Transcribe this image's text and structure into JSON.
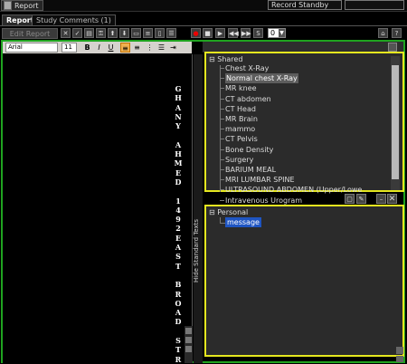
{
  "header": {
    "report_menu": "Report",
    "record_status": "Record Standby"
  },
  "tabs": [
    {
      "label": "Report"
    },
    {
      "label": "Study Comments (1)"
    }
  ],
  "toolbar": {
    "edit_report": "Edit Report",
    "zoom_select_value": "0",
    "help_label": "?"
  },
  "format": {
    "font": "Arial",
    "size": "11",
    "bold": "B",
    "italic": "I",
    "underline": "U"
  },
  "editor": {
    "vertical_text": "G H A N Y  A H M E D  1 4 9 2 E A S T  B R O A D  S T R"
  },
  "sidebar": {
    "hide_label": "Hide Standard Texts"
  },
  "shared": {
    "root": "Shared",
    "items": [
      "Chest X-Ray",
      "Normal chest X-Ray",
      "MR knee",
      "CT abdomen",
      "CT Head",
      "MR Brain",
      "mammo",
      "CT Pelvis",
      "Bone Density",
      "Surgery",
      "BARIUM MEAL",
      "MRI LUMBAR SPINE",
      "ULTRASOUND ABDOMEN (Upper/Lowe",
      "Intravenous Urogram"
    ],
    "selected_index": 1
  },
  "personal": {
    "root": "Personal",
    "items": [
      "message"
    ]
  },
  "colors": {
    "frame_green": "#1fa31f",
    "panel_yellow": "#e5e71f",
    "selection_blue": "#1f55c2"
  }
}
